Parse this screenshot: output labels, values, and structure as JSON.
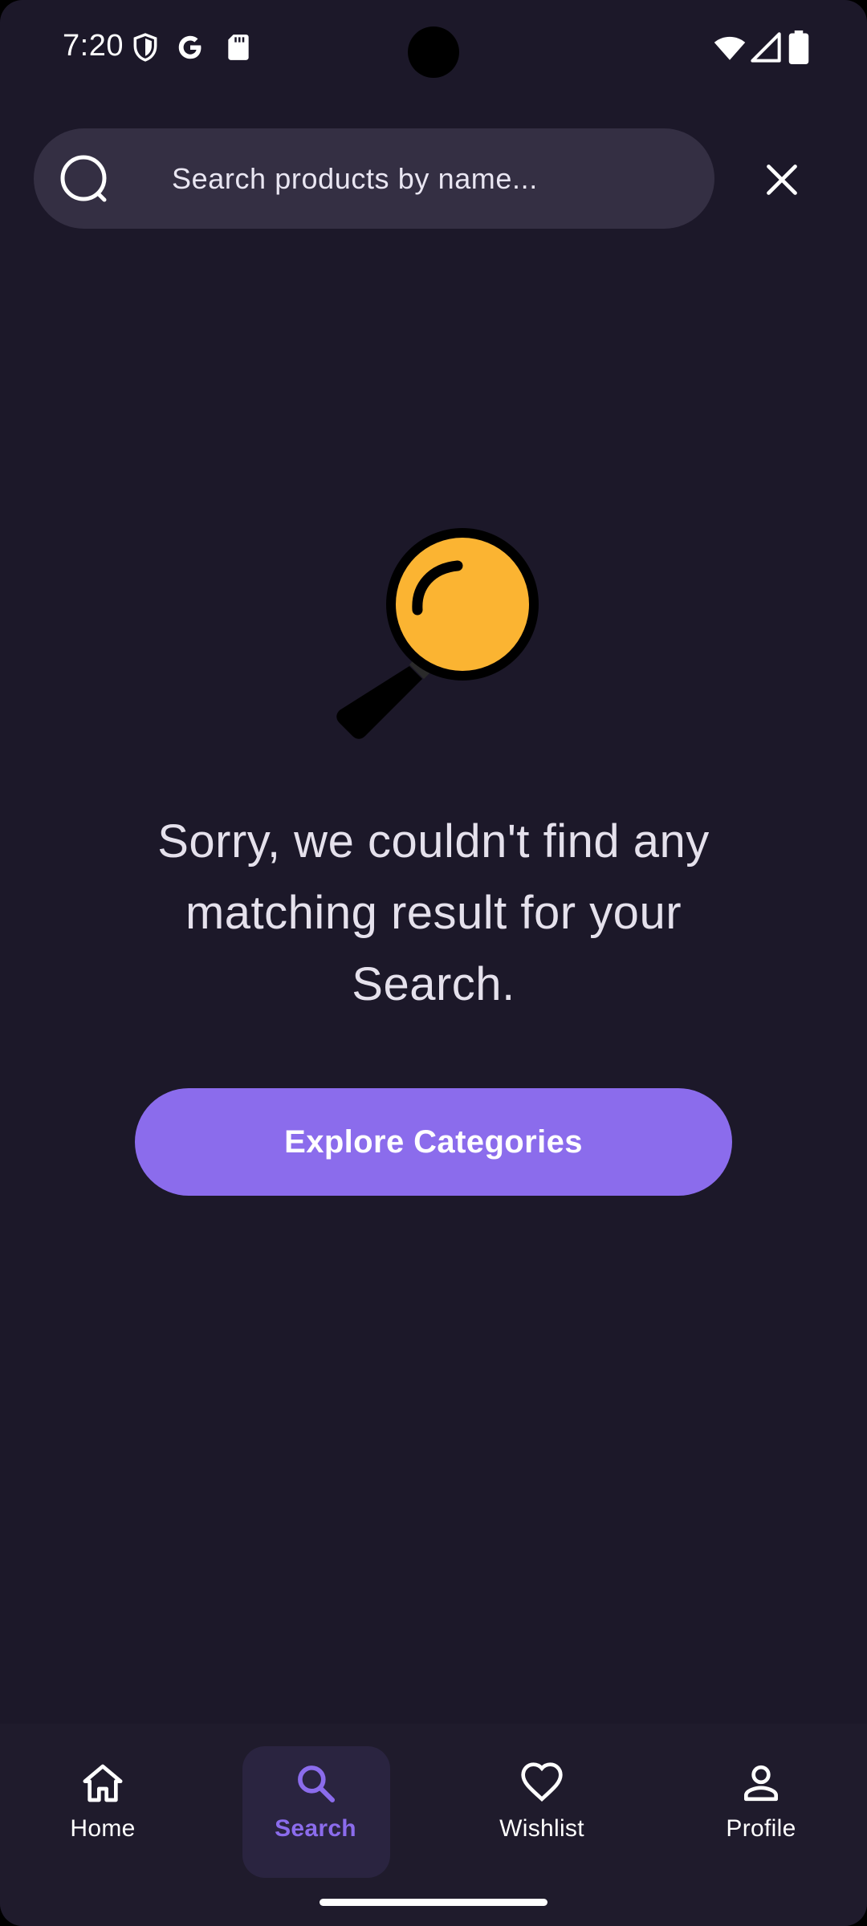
{
  "status_bar": {
    "time": "7:20",
    "icons": [
      "vpn-shield-icon",
      "google-icon",
      "sd-card-icon",
      "wifi-icon",
      "cell-signal-icon",
      "battery-icon"
    ]
  },
  "search": {
    "placeholder": "Search products by name...",
    "value": "",
    "leading_icon": "loading-spinner-icon",
    "clear_icon": "close-icon"
  },
  "empty_state": {
    "illustration": "magnifying-glass-illustration",
    "message": "Sorry, we couldn't find any matching result for your Search.",
    "action_label": "Explore Categories"
  },
  "bottom_nav": {
    "items": [
      {
        "label": "Home",
        "icon": "home-icon",
        "active": false
      },
      {
        "label": "Search",
        "icon": "search-icon",
        "active": true
      },
      {
        "label": "Wishlist",
        "icon": "heart-icon",
        "active": false
      },
      {
        "label": "Profile",
        "icon": "person-icon",
        "active": false
      }
    ]
  },
  "colors": {
    "background": "#1c1829",
    "search_field": "#342f43",
    "accent": "#8b6cec",
    "illustration_lens": "#fbb432",
    "text": "#e5e1ec"
  }
}
